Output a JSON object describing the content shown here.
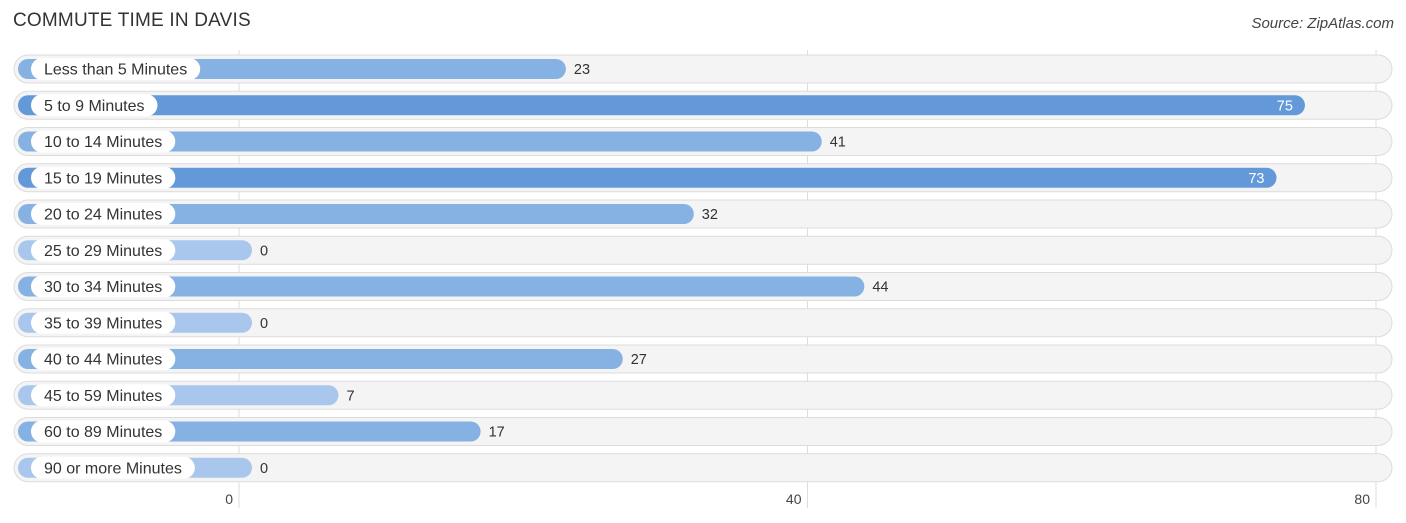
{
  "header": {
    "title": "COMMUTE TIME IN DAVIS",
    "source": "Source: ZipAtlas.com"
  },
  "chart_data": {
    "type": "bar",
    "orientation": "horizontal",
    "title": "COMMUTE TIME IN DAVIS",
    "xlabel": "",
    "ylabel": "",
    "xlim": [
      0,
      80
    ],
    "xticks": [
      0,
      40,
      80
    ],
    "grid": true,
    "categories": [
      "Less than 5 Minutes",
      "5 to 9 Minutes",
      "10 to 14 Minutes",
      "15 to 19 Minutes",
      "20 to 24 Minutes",
      "25 to 29 Minutes",
      "30 to 34 Minutes",
      "35 to 39 Minutes",
      "40 to 44 Minutes",
      "45 to 59 Minutes",
      "60 to 89 Minutes",
      "90 or more Minutes"
    ],
    "values": [
      23,
      75,
      41,
      73,
      32,
      0,
      44,
      0,
      27,
      7,
      17,
      0
    ],
    "colors": {
      "strong": "#6399d8",
      "medium": "#86b1e3",
      "light": "#a9c7ec"
    }
  }
}
